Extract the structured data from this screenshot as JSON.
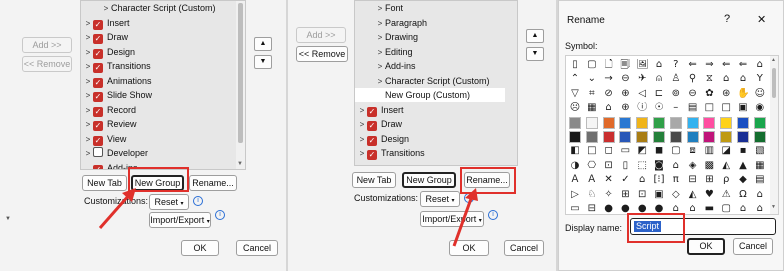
{
  "panel1": {
    "add_button": "Add >>",
    "remove_button": "<< Remove",
    "tree": [
      {
        "label": "Character Script (Custom)",
        "indent": 2,
        "expander": "chevron-right"
      },
      {
        "label": "Insert",
        "indent": 0,
        "expander": "chevron-right",
        "checked": true
      },
      {
        "label": "Draw",
        "indent": 0,
        "expander": "chevron-right",
        "checked": true
      },
      {
        "label": "Design",
        "indent": 0,
        "expander": "chevron-right",
        "checked": true
      },
      {
        "label": "Transitions",
        "indent": 0,
        "expander": "chevron-right",
        "checked": true
      },
      {
        "label": "Animations",
        "indent": 0,
        "expander": "chevron-right",
        "checked": true
      },
      {
        "label": "Slide Show",
        "indent": 0,
        "expander": "chevron-right",
        "checked": true
      },
      {
        "label": "Record",
        "indent": 0,
        "expander": "chevron-right",
        "checked": true
      },
      {
        "label": "Review",
        "indent": 0,
        "expander": "chevron-right",
        "checked": true
      },
      {
        "label": "View",
        "indent": 0,
        "expander": "chevron-right",
        "checked": true
      },
      {
        "label": "Developer",
        "indent": 0,
        "expander": "chevron-right",
        "checked": false
      },
      {
        "label": "Add-ins",
        "indent": 0,
        "expander": "none",
        "checked": true
      }
    ],
    "new_tab": "New Tab",
    "new_group": "New Group",
    "rename": "Rename...",
    "customizations_label": "Customizations:",
    "reset": "Reset",
    "import_export": "Import/Export",
    "ok": "OK",
    "cancel": "Cancel"
  },
  "panel2": {
    "add_button": "Add >>",
    "remove_button": "<< Remove",
    "tree": [
      {
        "label": "Font",
        "indent": 2,
        "expander": "chevron-right"
      },
      {
        "label": "Paragraph",
        "indent": 2,
        "expander": "chevron-right"
      },
      {
        "label": "Drawing",
        "indent": 2,
        "expander": "chevron-right"
      },
      {
        "label": "Editing",
        "indent": 2,
        "expander": "chevron-right"
      },
      {
        "label": "Add-ins",
        "indent": 2,
        "expander": "chevron-right"
      },
      {
        "label": "Character Script (Custom)",
        "indent": 2,
        "expander": "chevron-right"
      },
      {
        "label": "New Group (Custom)",
        "indent": 2,
        "expander": "none",
        "selected": true
      },
      {
        "label": "Insert",
        "indent": 0,
        "expander": "chevron-right",
        "checked": true
      },
      {
        "label": "Draw",
        "indent": 0,
        "expander": "chevron-right",
        "checked": true
      },
      {
        "label": "Design",
        "indent": 0,
        "expander": "chevron-right",
        "checked": true
      },
      {
        "label": "Transitions",
        "indent": 0,
        "expander": "chevron-right",
        "checked": true
      }
    ],
    "new_tab": "New Tab",
    "new_group": "New Group",
    "rename": "Rename...",
    "customizations_label": "Customizations:",
    "reset": "Reset",
    "import_export": "Import/Export",
    "ok": "OK",
    "cancel": "Cancel"
  },
  "rename_dialog": {
    "title": "Rename",
    "help": "?",
    "close": "✕",
    "symbol_label": "Symbol:",
    "display_name_label": "Display name:",
    "display_name_value": "Script",
    "ok": "OK",
    "cancel": "Cancel",
    "symbol_rows": [
      [
        "▯",
        "▢",
        "🗋",
        "🗐",
        "🖼",
        "⌂",
        "?",
        "⇐",
        "⇒",
        "⇐",
        "⇐",
        "⌂"
      ],
      [
        "⌃",
        "⌄",
        "→",
        "⊖",
        "✈",
        "⍝",
        "♙",
        "⚲",
        "⧖",
        "⌂",
        "⌂",
        "Y"
      ],
      [
        "▽",
        "⌗",
        "⊘",
        "⊕",
        "◁",
        "⊏",
        "⊚",
        "⊖",
        "✿",
        "⊛",
        "✋",
        "☺"
      ],
      [
        "☹",
        "▦",
        "⌂",
        "⊕",
        "ⓘ",
        "☉",
        "–",
        "▤",
        "□",
        "□",
        "▣",
        "◉"
      ],
      [
        "#8a8a8a",
        "#f5f5f5",
        "#e06a2a",
        "#2a78d2",
        "#f0b419",
        "#30a048",
        "#a8a8a8",
        "#33b2ef",
        "#ff4ea1",
        "#ffd21a",
        "#1a4fc2",
        "#1aa64d"
      ],
      [
        "#1a1a1a",
        "#6f6f6f",
        "#c92f2f",
        "#2857b8",
        "#a97d14",
        "#24803a",
        "#4a4a4a",
        "#1f7fbf",
        "#c0157a",
        "#bf9a13",
        "#1a2f94",
        "#146e2f"
      ],
      [
        "◧",
        "□",
        "◻",
        "▭",
        "◩",
        "◼",
        "▢",
        "⧈",
        "▥",
        "◪",
        "▪",
        "▧"
      ],
      [
        "◑",
        "⎔",
        "⊡",
        "▯",
        "⬚",
        "◙",
        "⌂",
        "◈",
        "▩",
        "◭",
        "▲",
        "▦"
      ],
      [
        "Ａ",
        "Ａ",
        "✕",
        "✓",
        "⌂",
        "[⁝]",
        "π",
        "⊟",
        "⊞",
        "ρ",
        "◆",
        "▤"
      ],
      [
        "▷",
        "♘",
        "✧",
        "⊞",
        "⊡",
        "▣",
        "◇",
        "◭",
        "♥",
        "⚠",
        "Ω",
        "⌂"
      ],
      [
        "▭",
        "⊟",
        "●",
        "●",
        "●",
        "●",
        "⌂",
        "⌂",
        "▬",
        "▢",
        "⌂",
        "⌂"
      ]
    ]
  }
}
